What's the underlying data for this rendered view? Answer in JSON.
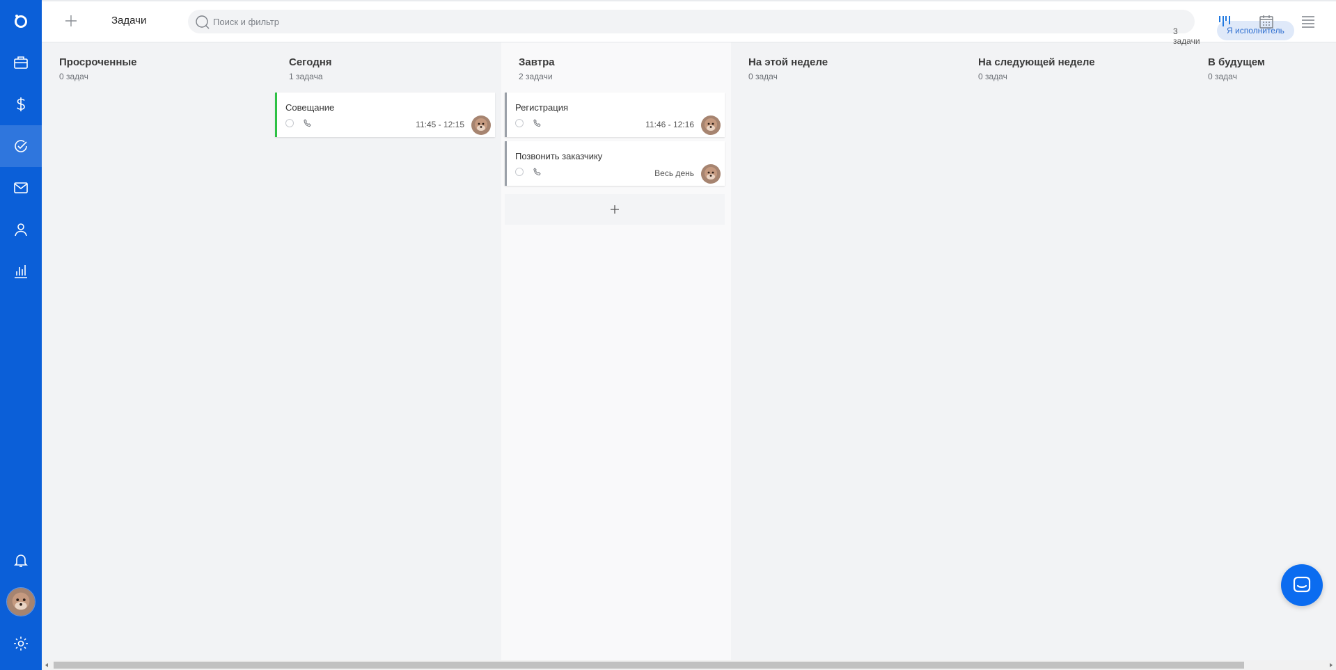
{
  "header": {
    "title": "Задачи",
    "search_placeholder": "Поиск и фильтр",
    "task_count": "3 задачи",
    "filter_chip": "Я исполнитель"
  },
  "columns": [
    {
      "title": "Просроченные",
      "count": "0 задач",
      "cards": []
    },
    {
      "title": "Сегодня",
      "count": "1 задача",
      "cards": [
        {
          "title": "Совещание",
          "time": "11:45 - 12:15",
          "accent": "#2ec145"
        }
      ]
    },
    {
      "title": "Завтра",
      "count": "2 задачи",
      "cards": [
        {
          "title": "Регистрация",
          "time": "11:46 - 12:16"
        },
        {
          "title": "Позвонить заказчику",
          "time": "Весь день"
        }
      ]
    },
    {
      "title": "На этой неделе",
      "count": "0 задач",
      "cards": []
    },
    {
      "title": "На следующей неделе",
      "count": "0 задач",
      "cards": []
    },
    {
      "title": "В будущем",
      "count": "0 задач",
      "cards": []
    }
  ],
  "sidebar": {
    "items": [
      {
        "name": "logo-icon"
      },
      {
        "name": "deals-briefcase-icon"
      },
      {
        "name": "finance-dollar-icon"
      },
      {
        "name": "tasks-check-icon",
        "active": true
      },
      {
        "name": "mail-icon"
      },
      {
        "name": "contacts-person-icon"
      },
      {
        "name": "analytics-chart-icon"
      },
      {
        "name": "notifications-bell-icon"
      },
      {
        "name": "user-avatar"
      },
      {
        "name": "settings-gear-icon"
      }
    ]
  },
  "toolbar_icons": [
    "kanban-view-icon",
    "calendar-view-icon",
    "list-view-icon",
    "more-options-icon"
  ],
  "colors": {
    "sidebar": "#0b5fd8",
    "accent_green": "#2ec145",
    "chip_bg": "#dfe9f9",
    "chip_text": "#2f6fd0",
    "chat_button": "#0b6cf0"
  }
}
